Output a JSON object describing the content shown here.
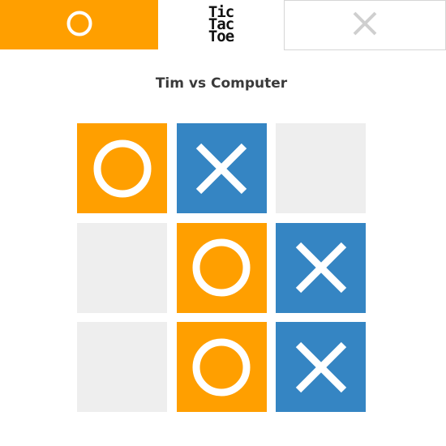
{
  "colors": {
    "o": "#ff9f00",
    "x": "#3585c3",
    "empty": "#eeeeee",
    "mark": "#ffffff",
    "x_header": "#cfcfcf"
  },
  "header": {
    "player_o_mark": "O",
    "player_x_mark": "X",
    "logo_lines": [
      "Tic",
      "Tac",
      "Toe"
    ]
  },
  "matchup": "Tim vs Computer",
  "board": [
    "O",
    "X",
    "",
    "",
    "O",
    "X",
    "",
    "O",
    "X"
  ]
}
